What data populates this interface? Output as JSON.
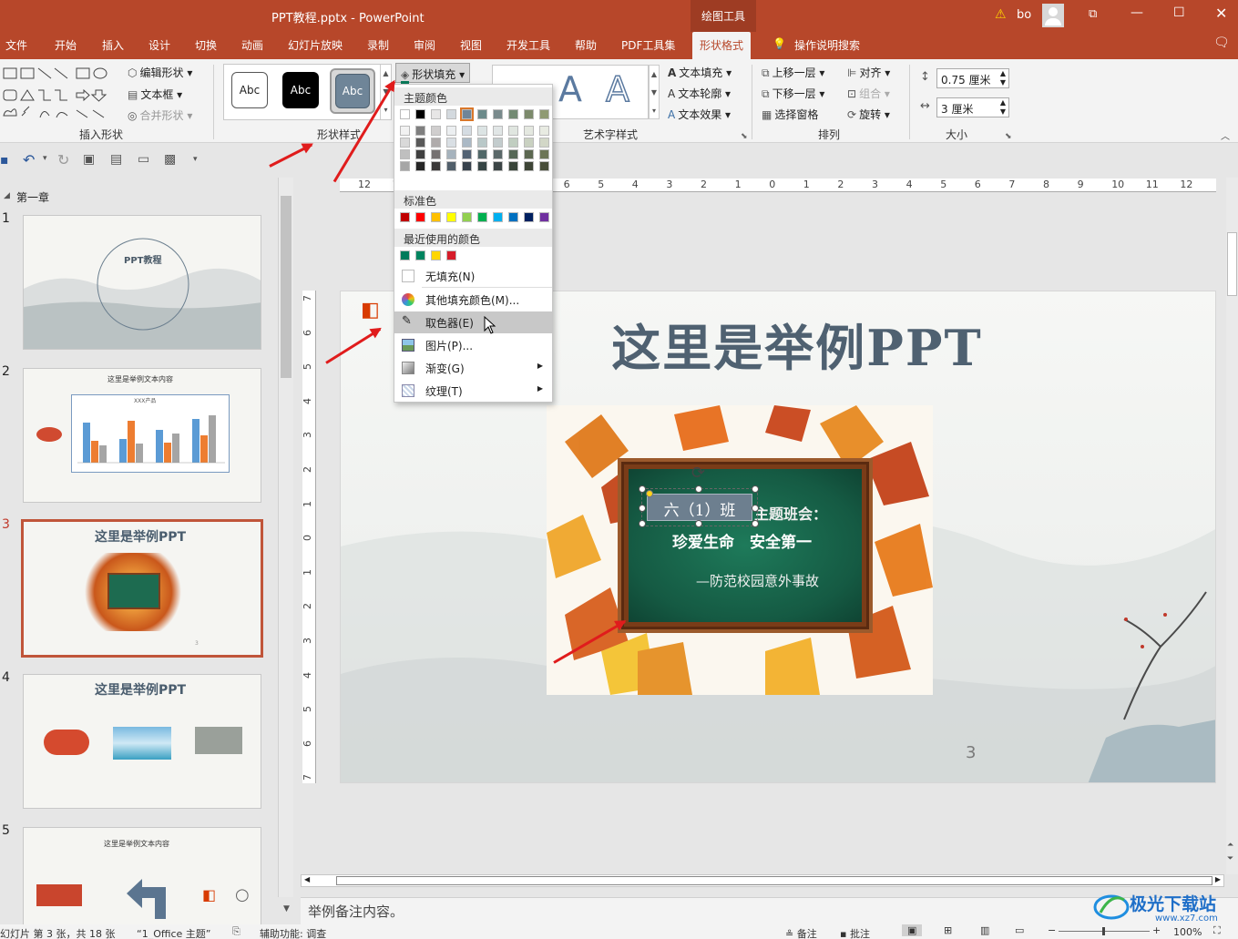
{
  "window": {
    "title": "PPT教程.pptx  -  PowerPoint",
    "context_tab": "绘图工具",
    "user": "bo",
    "warning_icon": "warning-icon"
  },
  "tabs": [
    "文件",
    "开始",
    "插入",
    "设计",
    "切换",
    "动画",
    "幻灯片放映",
    "录制",
    "审阅",
    "视图",
    "开发工具",
    "帮助",
    "PDF工具集",
    "形状格式",
    "操作说明搜索"
  ],
  "ribbon": {
    "insert_shapes": {
      "label": "插入形状",
      "edit_shape": "编辑形状",
      "text_box": "文本框",
      "merge_shapes": "合并形状"
    },
    "shape_styles": {
      "label": "形状样式",
      "previews": [
        "Abc",
        "Abc",
        "Abc"
      ],
      "fill_button": "形状填充"
    },
    "art_styles": {
      "label": "艺术字样式",
      "text_fill": "文本填充",
      "text_outline": "文本轮廓",
      "text_effects": "文本效果"
    },
    "arrange": {
      "label": "排列",
      "bring_forward": "上移一层",
      "send_backward": "下移一层",
      "selection_pane": "选择窗格",
      "align": "对齐",
      "group": "组合",
      "rotate": "旋转"
    },
    "size": {
      "label": "大小",
      "height": "0.75 厘米",
      "width": "3 厘米"
    }
  },
  "fill_menu": {
    "theme_colors_label": "主题颜色",
    "theme_row": [
      "#ffffff",
      "#000000",
      "#e7e6e6",
      "#d3d9de",
      "#6f8598",
      "#6c8a8a",
      "#798a8c",
      "#738a73",
      "#7c8a6c",
      "#8f9a73"
    ],
    "theme_shades": [
      [
        "#f2f2f2",
        "#d9d9d9",
        "#bfbfbf",
        "#a6a6a6"
      ],
      [
        "#7f7f7f",
        "#595959",
        "#404040",
        "#262626"
      ],
      [
        "#d0cece",
        "#afabab",
        "#757171",
        "#3a3838"
      ],
      [
        "#eceff1",
        "#d9dfe4",
        "#a6b3bd",
        "#515f6b"
      ],
      [
        "#d5dce2",
        "#abb9c5",
        "#536374",
        "#37424d"
      ],
      [
        "#dce4e4",
        "#b9c8c8",
        "#516868",
        "#364545"
      ],
      [
        "#e1e6e6",
        "#c3cccd",
        "#5a6869",
        "#3c4546"
      ],
      [
        "#e0e6e0",
        "#c1cec1",
        "#566856",
        "#394539"
      ],
      [
        "#e4e8e0",
        "#c9d1c1",
        "#5c6851",
        "#3e4536"
      ],
      [
        "#e8ebe2",
        "#d2d7c7",
        "#6c7556",
        "#484e39"
      ]
    ],
    "standard_label": "标准色",
    "standard": [
      "#c00000",
      "#ff0000",
      "#ffc000",
      "#ffff00",
      "#92d050",
      "#00b050",
      "#00b0f0",
      "#0070c0",
      "#002060",
      "#7030a0"
    ],
    "recent_label": "最近使用的颜色",
    "recent": [
      "#007a5a",
      "#00845f",
      "#ffd600",
      "#d61c2a"
    ],
    "no_fill": "无填充(N)",
    "more_colors": "其他填充颜色(M)...",
    "eyedropper": "取色器(E)",
    "picture": "图片(P)...",
    "gradient": "渐变(G)",
    "texture": "纹理(T)"
  },
  "ruler": {
    "top": [
      "12",
      "11",
      "10",
      "9",
      "8",
      "7",
      "6",
      "5",
      "4",
      "3",
      "2",
      "1",
      "0",
      "1",
      "2",
      "3",
      "4",
      "5",
      "6",
      "7",
      "8",
      "9",
      "10",
      "11",
      "12"
    ],
    "left": [
      "7",
      "6",
      "5",
      "4",
      "3",
      "2",
      "1",
      "0",
      "1",
      "2",
      "3",
      "4",
      "5",
      "6",
      "7"
    ]
  },
  "thumbnails": {
    "section": "第一章",
    "slides": [
      {
        "num": "1",
        "title": "PPT教程"
      },
      {
        "num": "2",
        "title": "这里是举例文本内容",
        "chart_title": "XXX产品"
      },
      {
        "num": "3",
        "title": "这里是举例PPT",
        "page": "3"
      },
      {
        "num": "4",
        "title": "这里是举例PPT"
      },
      {
        "num": "5",
        "title": "这里是举例文本内容"
      }
    ]
  },
  "slide": {
    "title": "这里是举例PPT",
    "board_class": "六（1）班",
    "board_theme_suffix": "主题班会：",
    "board_line2": "珍爱生命　安全第一",
    "board_line3": "—防范校园意外事故",
    "page_number": "3"
  },
  "notes": "举例备注内容。",
  "status": {
    "slide_info": "幻灯片 第 3 张，共 18 张",
    "theme": "“1_Office 主题”",
    "accessibility": "辅助功能: 调查",
    "notes_btn": "备注",
    "comments_btn": "批注",
    "zoom": "100%"
  },
  "watermark": "极光下载站",
  "watermark_url": "www.xz7.com"
}
